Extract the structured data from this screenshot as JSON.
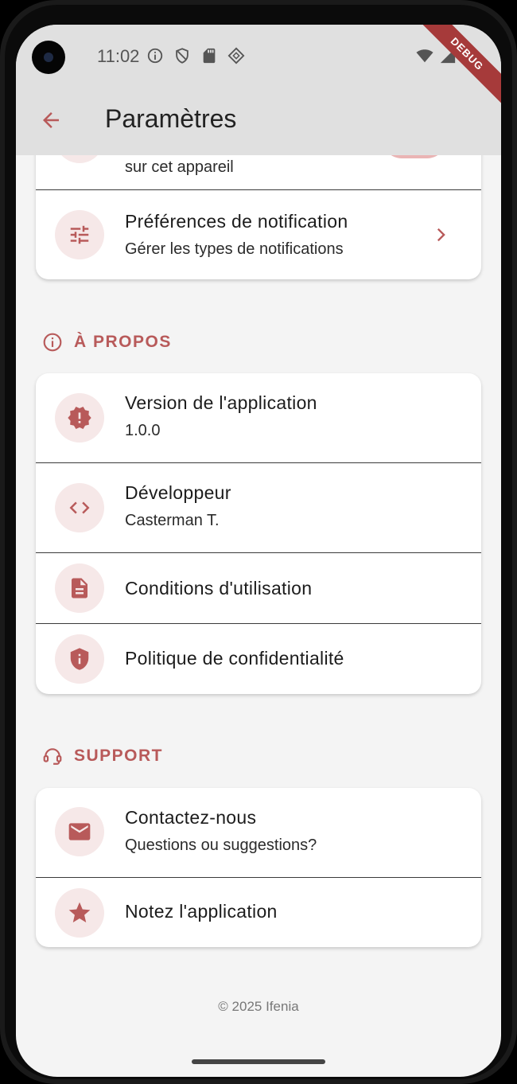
{
  "status_bar": {
    "time": "11:02"
  },
  "debug_label": "DEBUG",
  "app_bar": {
    "title": "Paramètres"
  },
  "notifications_card": {
    "partial_subtitle": "sur cet appareil",
    "prefs_title": "Préférences de notification",
    "prefs_subtitle": "Gérer les types de notifications"
  },
  "about_section": {
    "header": "À PROPOS",
    "items": [
      {
        "title": "Version de l'application",
        "subtitle": "1.0.0",
        "icon": "new-releases-icon"
      },
      {
        "title": "Développeur",
        "subtitle": "Casterman T.",
        "icon": "code-icon"
      },
      {
        "title": "Conditions d'utilisation",
        "icon": "description-icon"
      },
      {
        "title": "Politique de confidentialité",
        "icon": "privacy-shield-icon"
      }
    ]
  },
  "support_section": {
    "header": "SUPPORT",
    "items": [
      {
        "title": "Contactez-nous",
        "subtitle": "Questions ou suggestions?",
        "icon": "mail-icon"
      },
      {
        "title": "Notez l'application",
        "icon": "star-icon"
      }
    ]
  },
  "footer": {
    "copyright": "© 2025 Ifenia"
  },
  "colors": {
    "accent": "#b85a5a",
    "icon_bg": "#f6e8e8",
    "appbar": "#e0e0e0",
    "page_bg": "#f4f4f4"
  }
}
